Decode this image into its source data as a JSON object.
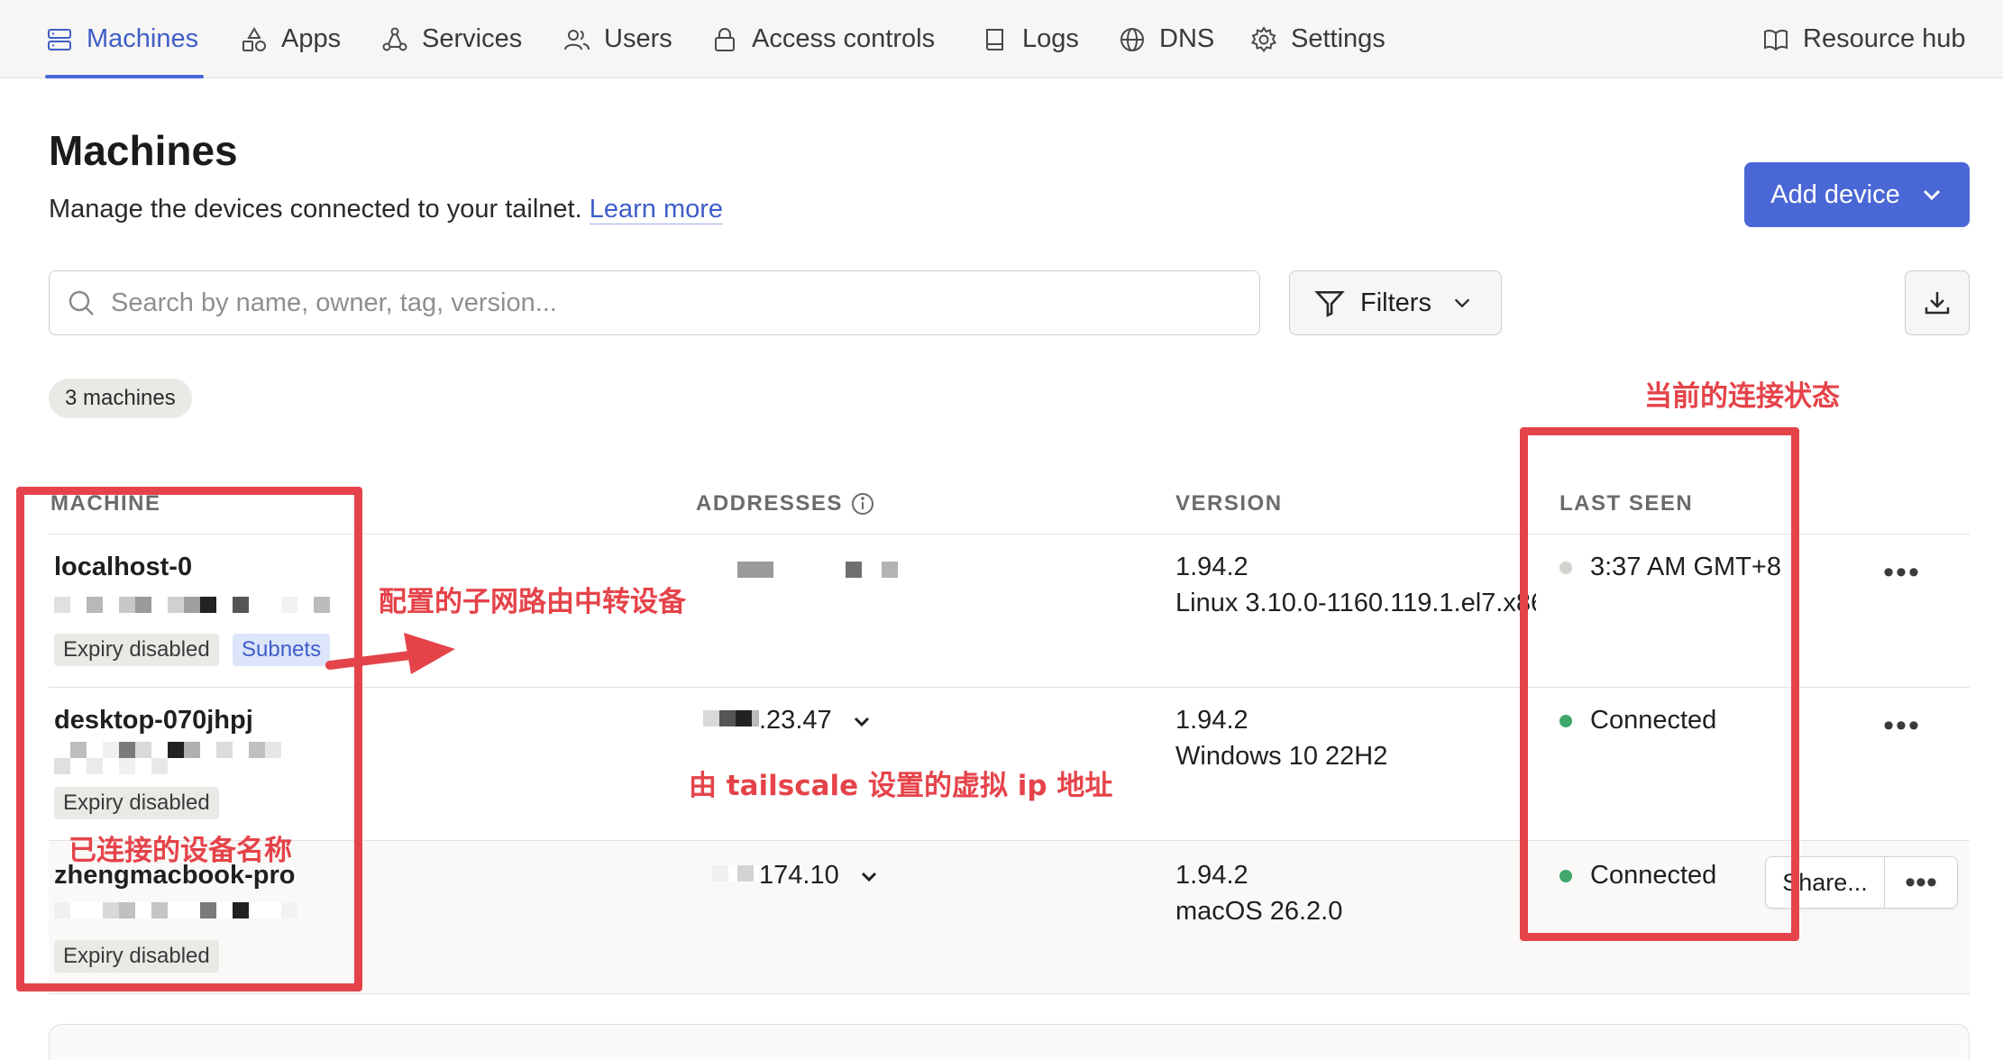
{
  "nav": {
    "items": [
      {
        "label": "Machines",
        "icon": "server-icon"
      },
      {
        "label": "Apps",
        "icon": "shapes-icon"
      },
      {
        "label": "Services",
        "icon": "network-icon"
      },
      {
        "label": "Users",
        "icon": "users-icon"
      },
      {
        "label": "Access controls",
        "icon": "lock-icon"
      },
      {
        "label": "Logs",
        "icon": "book-icon"
      },
      {
        "label": "DNS",
        "icon": "globe-icon"
      },
      {
        "label": "Settings",
        "icon": "gear-icon"
      }
    ],
    "resource_hub": "Resource hub",
    "active": "Machines"
  },
  "header": {
    "title": "Machines",
    "subtitle": "Manage the devices connected to your tailnet.",
    "learn_more": "Learn more",
    "add_device": "Add device"
  },
  "toolbar": {
    "search_placeholder": "Search by name, owner, tag, version...",
    "filters": "Filters"
  },
  "count": "3 machines",
  "table": {
    "columns": [
      "MACHINE",
      "ADDRESSES",
      "VERSION",
      "LAST SEEN"
    ],
    "rows": [
      {
        "name": "localhost-0",
        "tags": [
          "Expiry disabled",
          "Subnets"
        ],
        "address": "",
        "version": "1.94.2",
        "os": "Linux 3.10.0-1160.119.1.el7.x86...",
        "last_seen": "3:37 AM GMT+8",
        "status_color": "#d4d2cf"
      },
      {
        "name": "desktop-070jhpj",
        "tags": [
          "Expiry disabled"
        ],
        "address": ".23.47",
        "version": "1.94.2",
        "os": "Windows 10 22H2",
        "last_seen": "Connected",
        "status_color": "#3fa86a"
      },
      {
        "name": "zhengmacbook-pro",
        "tags": [
          "Expiry disabled"
        ],
        "address": "174.10",
        "version": "1.94.2",
        "os": "macOS 26.2.0",
        "last_seen": "Connected",
        "status_color": "#3fa86a",
        "share": "Share..."
      }
    ]
  },
  "annotations": {
    "status": "当前的连接状态",
    "subnet_router": "配置的子网路由中转设备",
    "virtual_ip": "由 tailscale 设置的虚拟 ip 地址",
    "device_names": "已连接的设备名称"
  },
  "colors": {
    "accent": "#4a67d6",
    "annotation": "#e5434a",
    "connected": "#3fa86a"
  }
}
